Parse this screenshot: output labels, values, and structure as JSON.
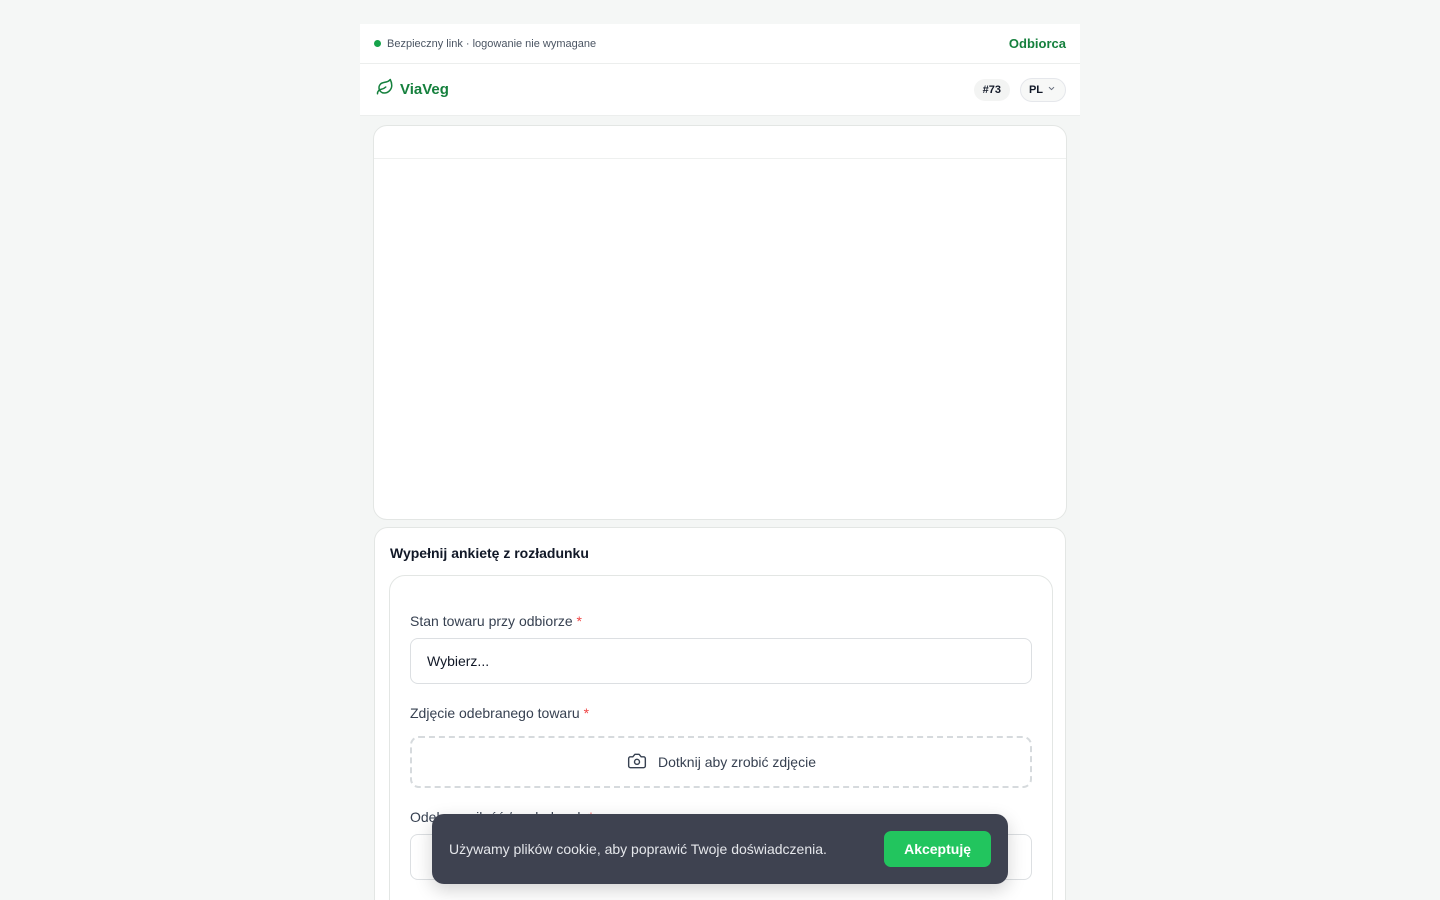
{
  "topbar": {
    "secure_text": "Bezpieczny link · logowanie nie wymagane",
    "role": "Odbiorca"
  },
  "header": {
    "brand": "ViaVeg",
    "order_badge": "#73",
    "language": "PL"
  },
  "survey": {
    "title": "Wypełnij ankietę z rozładunku",
    "fields": [
      {
        "label": "Stan towaru przy odbiorze",
        "required_mark": "*",
        "placeholder": "Wybierz..."
      },
      {
        "label": "Zdjęcie odebranego towaru",
        "required_mark": "*",
        "action": "Dotknij aby zrobić zdjęcie"
      },
      {
        "label": "Odebrana ilość / rozładunek",
        "required_mark": "*"
      }
    ]
  },
  "cookie": {
    "text": "Używamy plików cookie, aby poprawić Twoje doświadczenia.",
    "accept": "Akceptuję"
  },
  "colors": {
    "brand": "#15803d",
    "status_dot": "#16a34a",
    "accept_button": "#22c55e",
    "required": "#ef4444"
  }
}
